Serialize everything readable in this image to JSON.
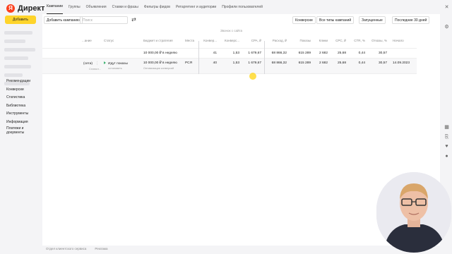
{
  "app": {
    "logo_text": "Директ",
    "logo_letter": "Я"
  },
  "sidebar": {
    "add_button": "Добавить",
    "items": [
      {
        "label": "Рекомендации"
      },
      {
        "label": "Конверсии"
      },
      {
        "label": "Статистика"
      },
      {
        "label": "Библиотека"
      },
      {
        "label": "Инструменты"
      },
      {
        "label": "Информация"
      },
      {
        "label": "Платежи и документы"
      }
    ]
  },
  "tabs": [
    {
      "label": "Кампании",
      "active": true
    },
    {
      "label": "Группы"
    },
    {
      "label": "Объявления"
    },
    {
      "label": "Ставки и фразы"
    },
    {
      "label": "Фильтры фидов"
    },
    {
      "label": "Ретаргетинг и аудитории"
    },
    {
      "label": "Профили пользователей"
    }
  ],
  "toolbar": {
    "add_campaign": "Добавить кампанию",
    "search_placeholder": "Поиск",
    "conversions": "Конверсии",
    "all_types": "Все типы кампаний",
    "running": "Запущенные",
    "period": "Последние 30 дней"
  },
  "table": {
    "group_header": "Звонок с сайта",
    "columns": [
      "...ание",
      "Статус",
      "Бюджет и стратегия",
      "Места",
      "Конвер...",
      "Конверс...",
      "CPA, ₽",
      "Расход, ₽",
      "Показы",
      "Клики",
      "CPC, ₽",
      "CTR, %",
      "Отказы, %",
      "Начало"
    ],
    "total_row": [
      "41",
      "1,53",
      "1 679,67",
      "68 866,32",
      "615 289",
      "2 682",
      "25,68",
      "0,44",
      "30,57"
    ],
    "campaign_row": {
      "name_suffix": "(сети)",
      "name_sub": "Статист...",
      "status": "Идут показы",
      "status_action": "остановить",
      "budget": "10 000,00 ₽ в неделю",
      "strategy": "Оптимизация конверсий",
      "placement": "РСЯ",
      "conversions": "40",
      "values": [
        "1,53",
        "1 679,67",
        "68 866,32",
        "615 289",
        "2 682",
        "25,68",
        "0,44",
        "30,57"
      ],
      "start": "14.09.2023"
    },
    "budget_total": "10 000,00 ₽ в неделю"
  },
  "footer": {
    "links": [
      "Отдел клиентского сервиса",
      "Реклама"
    ]
  }
}
